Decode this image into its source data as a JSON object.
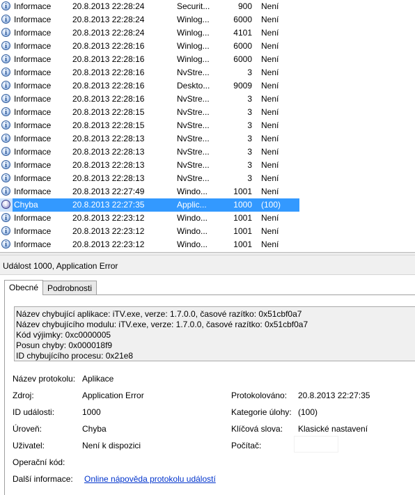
{
  "events": [
    {
      "level": "Informace",
      "date": "20.8.2013 22:28:24",
      "source": "Securit...",
      "id": "900",
      "task": "Není",
      "icon": "info-icon"
    },
    {
      "level": "Informace",
      "date": "20.8.2013 22:28:24",
      "source": "Winlog...",
      "id": "6000",
      "task": "Není",
      "icon": "info-icon"
    },
    {
      "level": "Informace",
      "date": "20.8.2013 22:28:24",
      "source": "Winlog...",
      "id": "4101",
      "task": "Není",
      "icon": "info-icon"
    },
    {
      "level": "Informace",
      "date": "20.8.2013 22:28:16",
      "source": "Winlog...",
      "id": "6000",
      "task": "Není",
      "icon": "info-icon"
    },
    {
      "level": "Informace",
      "date": "20.8.2013 22:28:16",
      "source": "Winlog...",
      "id": "6000",
      "task": "Není",
      "icon": "info-icon"
    },
    {
      "level": "Informace",
      "date": "20.8.2013 22:28:16",
      "source": "NvStre...",
      "id": "3",
      "task": "Není",
      "icon": "info-icon"
    },
    {
      "level": "Informace",
      "date": "20.8.2013 22:28:16",
      "source": "Deskto...",
      "id": "9009",
      "task": "Není",
      "icon": "info-icon"
    },
    {
      "level": "Informace",
      "date": "20.8.2013 22:28:16",
      "source": "NvStre...",
      "id": "3",
      "task": "Není",
      "icon": "info-icon"
    },
    {
      "level": "Informace",
      "date": "20.8.2013 22:28:15",
      "source": "NvStre...",
      "id": "3",
      "task": "Není",
      "icon": "info-icon"
    },
    {
      "level": "Informace",
      "date": "20.8.2013 22:28:15",
      "source": "NvStre...",
      "id": "3",
      "task": "Není",
      "icon": "info-icon"
    },
    {
      "level": "Informace",
      "date": "20.8.2013 22:28:13",
      "source": "NvStre...",
      "id": "3",
      "task": "Není",
      "icon": "info-icon"
    },
    {
      "level": "Informace",
      "date": "20.8.2013 22:28:13",
      "source": "NvStre...",
      "id": "3",
      "task": "Není",
      "icon": "info-icon"
    },
    {
      "level": "Informace",
      "date": "20.8.2013 22:28:13",
      "source": "NvStre...",
      "id": "3",
      "task": "Není",
      "icon": "info-icon"
    },
    {
      "level": "Informace",
      "date": "20.8.2013 22:28:13",
      "source": "NvStre...",
      "id": "3",
      "task": "Není",
      "icon": "info-icon"
    },
    {
      "level": "Informace",
      "date": "20.8.2013 22:27:49",
      "source": "Windo...",
      "id": "1001",
      "task": "Není",
      "icon": "info-icon"
    },
    {
      "level": "Chyba",
      "date": "20.8.2013 22:27:35",
      "source": "Applic...",
      "id": "1000",
      "task": "(100)",
      "icon": "error-icon"
    },
    {
      "level": "Informace",
      "date": "20.8.2013 22:23:12",
      "source": "Windo...",
      "id": "1001",
      "task": "Není",
      "icon": "info-icon"
    },
    {
      "level": "Informace",
      "date": "20.8.2013 22:23:12",
      "source": "Windo...",
      "id": "1001",
      "task": "Není",
      "icon": "info-icon"
    },
    {
      "level": "Informace",
      "date": "20.8.2013 22:23:12",
      "source": "Windo...",
      "id": "1001",
      "task": "Není",
      "icon": "info-icon"
    }
  ],
  "selected_index": 15,
  "colors": {
    "selection": "#3399ff",
    "link": "#0033cc",
    "panel_bg": "#f0f0f0"
  },
  "detail": {
    "title": "Událost 1000, Application Error",
    "tabs": [
      "Obecné",
      "Podrobnosti"
    ],
    "description": [
      "Název chybující aplikace: iTV.exe, verze: 1.7.0.0, časové razítko: 0x51cbf0a7",
      "Název chybujícího modulu: iTV.exe, verze: 1.7.0.0, časové razítko: 0x51cbf0a7",
      "Kód výjimky: 0xc0000005",
      "Posun chyby: 0x000018f9",
      "ID chybujícího procesu: 0x21e8"
    ],
    "fields": {
      "log_name_label": "Název protokolu:",
      "log_name_value": "Aplikace",
      "source_label": "Zdroj:",
      "source_value": "Application Error",
      "logged_label": "Protokolováno:",
      "logged_value": "20.8.2013 22:27:35",
      "event_id_label": "ID události:",
      "event_id_value": "1000",
      "task_category_label": "Kategorie úlohy:",
      "task_category_value": "(100)",
      "level_label": "Úroveň:",
      "level_value": "Chyba",
      "keywords_label": "Klíčová slova:",
      "keywords_value": "Klasické nastavení",
      "user_label": "Uživatel:",
      "user_value": "Není k dispozici",
      "computer_label": "Počítač:",
      "opcode_label": "Operační kód:",
      "more_info_label": "Další informace:",
      "more_info_link": "Online nápověda protokolu událostí"
    }
  }
}
